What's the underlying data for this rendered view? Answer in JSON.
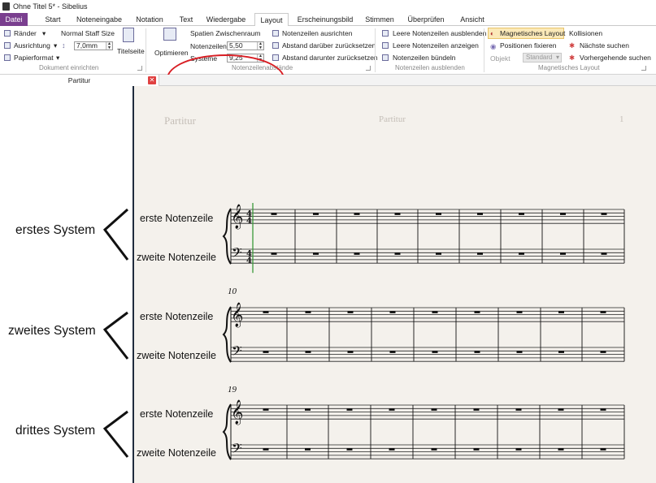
{
  "window": {
    "title": "Ohne Titel 5* - Sibelius"
  },
  "tabs": [
    "Datei",
    "Start",
    "Noteneingabe",
    "Notation",
    "Text",
    "Wiedergabe",
    "Layout",
    "Erscheinungsbild",
    "Stimmen",
    "Überprüfen",
    "Ansicht"
  ],
  "ribbon": {
    "document_setup": {
      "margins": "Ränder",
      "alignment": "Ausrichtung",
      "paper_format": "Papierformat",
      "staff_size_label": "Normal Staff Size",
      "staff_size_value": "7,0mm",
      "title_page": "Titelseite",
      "group": "Dokument einrichten"
    },
    "staff_spacing": {
      "optimize": "Optimieren",
      "space_header": "Spatien Zwischenraum",
      "staves_label": "Notenzeilen",
      "staves_value": "5,50",
      "systems_label": "Systeme",
      "systems_value": "9,25",
      "align": "Notenzeilen ausrichten",
      "reset_above": "Abstand darüber zurücksetzen",
      "reset_below": "Abstand darunter zurücksetzen",
      "group": "Notenzeilenabstände"
    },
    "hide_staves": {
      "hide_empty": "Leere Notenzeilen ausblenden",
      "show_empty": "Leere Notenzeilen anzeigen",
      "focus": "Notenzeilen bündeln",
      "group": "Notenzeilen ausblenden"
    },
    "magnetic": {
      "magnetic_layout": "Magnetisches Layout",
      "fix_positions": "Positionen fixieren",
      "object_label": "Objekt",
      "object_value": "Standard",
      "collisions": "Kollisionen",
      "find_next": "Nächste suchen",
      "find_prev": "Vorhergehende suchen",
      "group": "Magnetisches Layout"
    }
  },
  "document_tab": {
    "label": "Partitur",
    "close": "✕"
  },
  "score": {
    "header_left": "Partitur",
    "header_center": "Partitur",
    "page_number": "1",
    "time_signature": [
      "4",
      "4"
    ],
    "system_labels": [
      "erstes System",
      "zweites System",
      "drittes System"
    ],
    "staff_top": "erste Notenzeile",
    "staff_bottom": "zweite Notenzeile",
    "measure_numbers": [
      "10",
      "19"
    ]
  },
  "colors": {
    "file_tab": "#7a3f8f",
    "callout": "#d81e24",
    "highlight": "#fbe9b8",
    "paper": "#f4f1ec"
  }
}
